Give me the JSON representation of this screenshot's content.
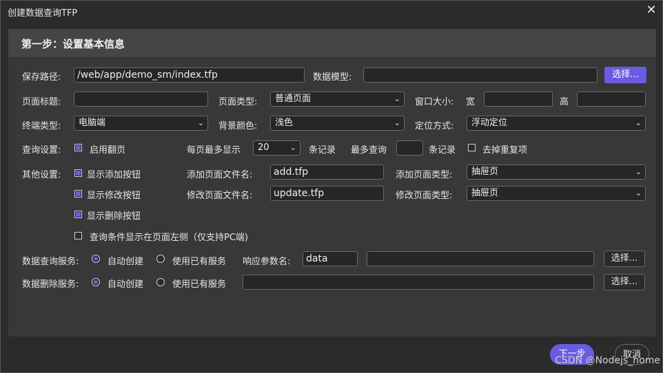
{
  "window": {
    "title": "创建数据查询TFP",
    "close_glyph": "✕"
  },
  "step_title": "第一步：设置基本信息",
  "row1": {
    "save_path_label": "保存路径:",
    "save_path_value": "/web/app/demo_sm/index.tfp",
    "data_model_label": "数据模型:",
    "data_model_value": "",
    "choose_label": "选择..."
  },
  "row2": {
    "page_title_label": "页面标题:",
    "page_title_value": "",
    "page_type_label": "页面类型:",
    "page_type_value": "普通页面",
    "window_size_label": "窗口大小:",
    "width_label": "宽",
    "width_value": "",
    "height_label": "高",
    "height_value": ""
  },
  "row3": {
    "terminal_type_label": "终端类型:",
    "terminal_type_value": "电脑端",
    "bg_color_label": "背景颜色:",
    "bg_color_value": "浅色",
    "position_mode_label": "定位方式:",
    "position_mode_value": "浮动定位"
  },
  "row4": {
    "query_settings_label": "查询设置:",
    "enable_paging_label": "启用翻页",
    "enable_paging_checked": true,
    "per_page_label": "每页最多显示",
    "per_page_value": "20",
    "records_label": "条记录",
    "max_query_label": "最多查询",
    "max_query_value": "",
    "records_label2": "条记录",
    "dedupe_label": "去掉重复项",
    "dedupe_checked": false
  },
  "other": {
    "label": "其他设置:",
    "show_add_label": "显示添加按钮",
    "show_edit_label": "显示修改按钮",
    "show_delete_label": "显示删除按钮",
    "query_left_label": "查询条件显示在页面左侧（仅支持PC端)",
    "add_file_label": "添加页面文件名:",
    "add_file_value": "add.tfp",
    "add_type_label": "添加页面类型:",
    "add_type_value": "抽屉页",
    "edit_file_label": "修改页面文件名:",
    "edit_file_value": "update.tfp",
    "edit_type_label": "修改页面类型:",
    "edit_type_value": "抽屉页"
  },
  "query_service": {
    "label": "数据查询服务:",
    "auto_create": "自动创建",
    "use_existing": "使用已有服务",
    "response_param_label": "响应参数名:",
    "response_param_value": "data",
    "service_value": "",
    "choose_label": "选择..."
  },
  "delete_service": {
    "label": "数据删除服务:",
    "auto_create": "自动创建",
    "use_existing": "使用已有服务",
    "service_value": "",
    "choose_label": "选择..."
  },
  "footer": {
    "next_label": "下一步",
    "cancel_label": "取消"
  },
  "watermark": "CSDN @Nodejs_home",
  "colors": {
    "accent": "#6a5ce0",
    "panel": "#383838",
    "header": "#454545",
    "background": "#2b2b2b"
  }
}
